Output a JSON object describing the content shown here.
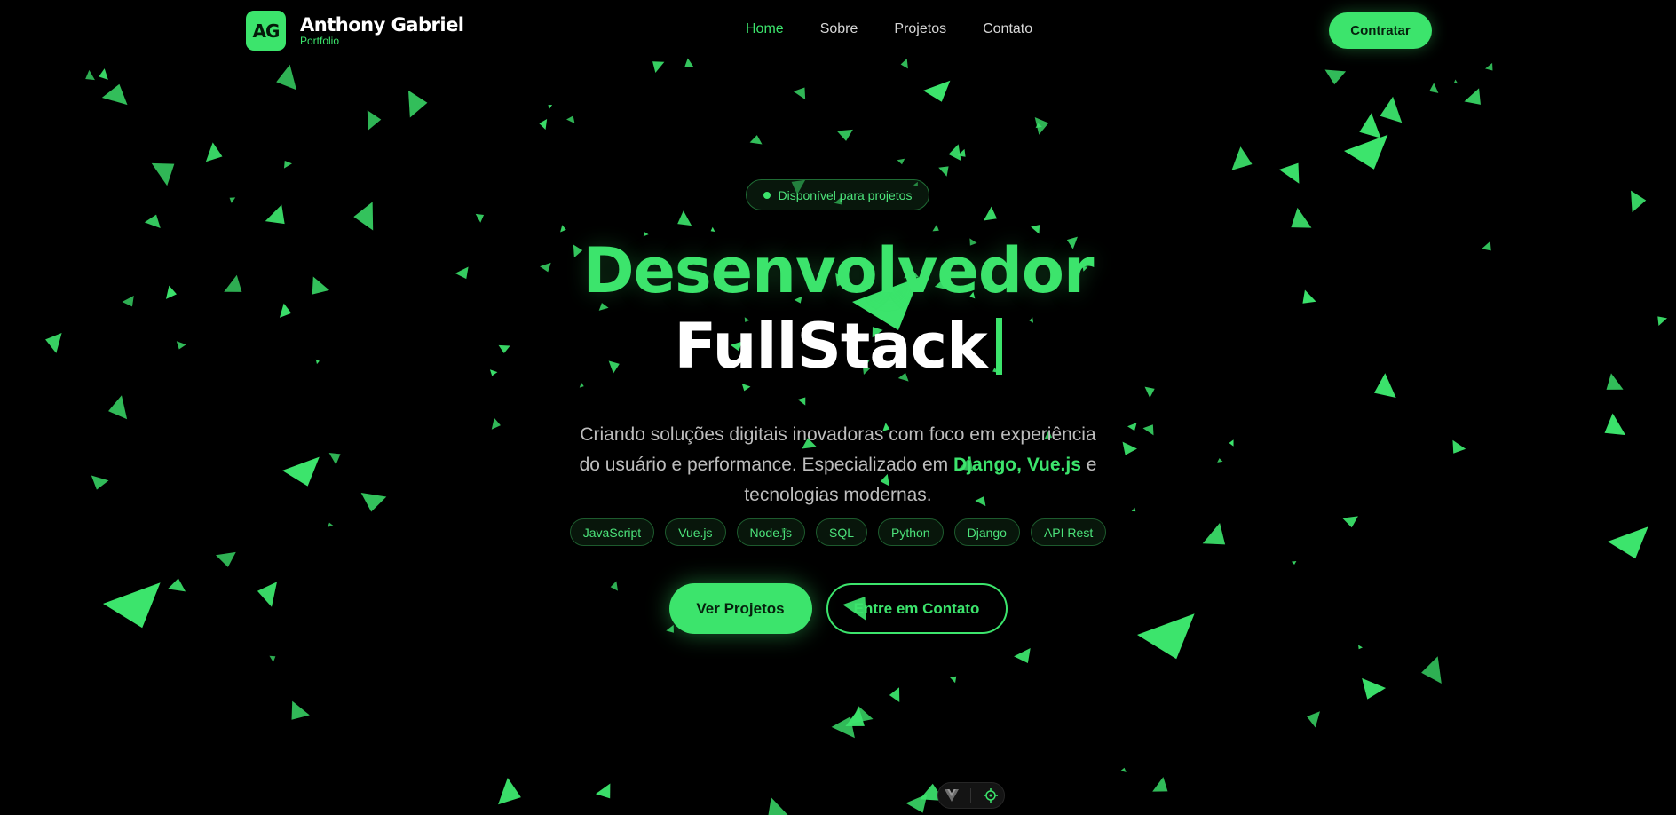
{
  "header": {
    "logo_text": "AG",
    "brand_name": "Anthony Gabriel",
    "brand_sub": "Portfolio",
    "nav": [
      {
        "label": "Home",
        "active": true
      },
      {
        "label": "Sobre",
        "active": false
      },
      {
        "label": "Projetos",
        "active": false
      },
      {
        "label": "Contato",
        "active": false
      }
    ],
    "hire_label": "Contratar"
  },
  "hero": {
    "badge": "Disponível para projetos",
    "title_line1": "Desenvolvedor",
    "title_line2": "FullStack",
    "description": {
      "part1": "Criando soluções digitais inovadoras com foco em experiência do usuário e performance. Especializado em ",
      "highlight1": "Django",
      "sep": ", ",
      "highlight2": "Vue.js",
      "part2": " e tecnologias modernas."
    },
    "tags": [
      "JavaScript",
      "Vue.js",
      "Node.js",
      "SQL",
      "Python",
      "Django",
      "API Rest"
    ],
    "primary_cta": "Ver Projetos",
    "secondary_cta": "Entre em Contato"
  },
  "devtools": {
    "icons": [
      "vue-logo-icon",
      "crosshair-icon"
    ]
  },
  "colors": {
    "accent": "#3ce46c",
    "background": "#000000",
    "text_muted": "#bdbdbd"
  }
}
